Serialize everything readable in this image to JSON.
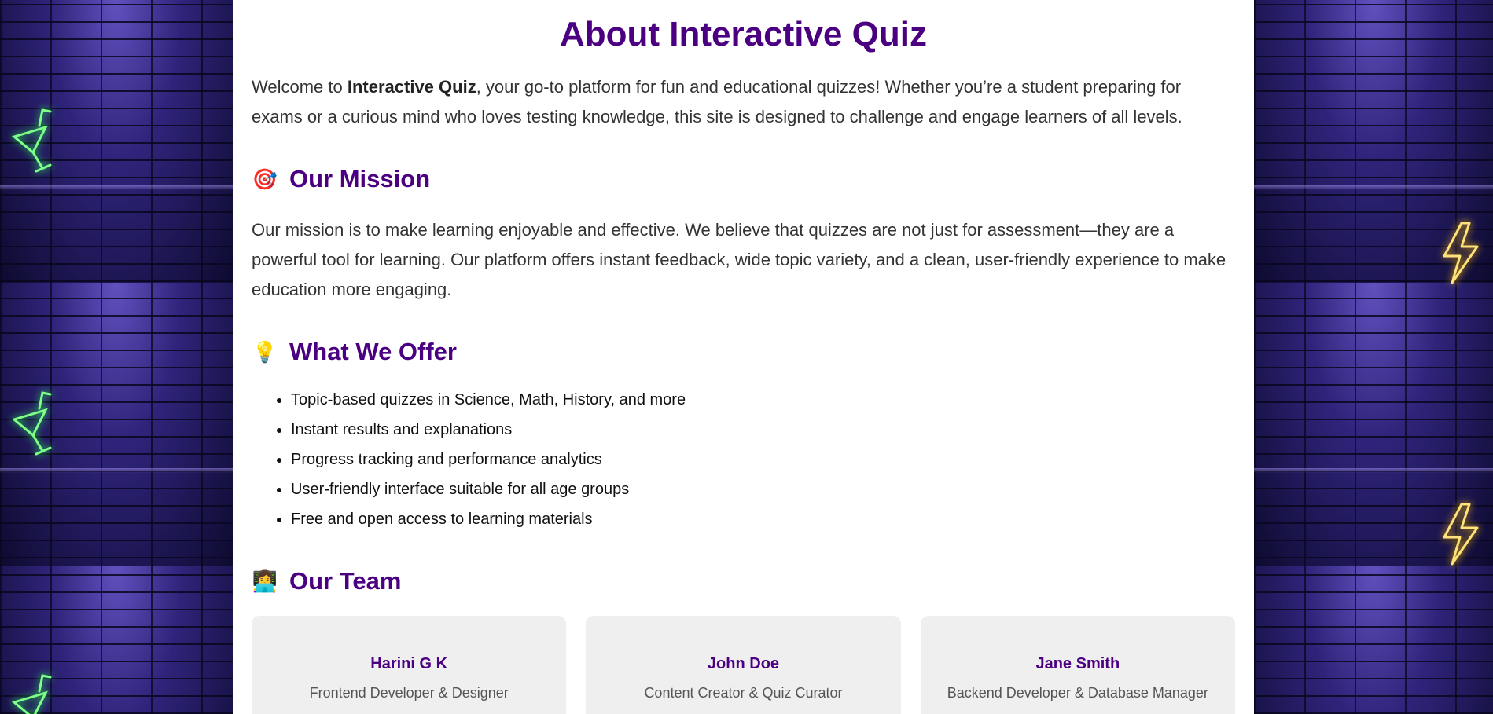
{
  "page": {
    "title": "About Interactive Quiz",
    "intro": {
      "prefix": "Welcome to ",
      "brand": "Interactive Quiz",
      "suffix": ", your go-to platform for fun and educational quizzes! Whether you’re a student preparing for exams or a curious mind who loves testing knowledge, this site is designed to challenge and engage learners of all levels."
    }
  },
  "mission": {
    "icon": "🎯",
    "heading": "Our Mission",
    "text": "Our mission is to make learning enjoyable and effective. We believe that quizzes are not just for assessment—they are a powerful tool for learning. Our platform offers instant feedback, wide topic variety, and a clean, user-friendly experience to make education more engaging."
  },
  "offer": {
    "icon": "💡",
    "heading": "What We Offer",
    "items": [
      "Topic-based quizzes in Science, Math, History, and more",
      "Instant results and explanations",
      "Progress tracking and performance analytics",
      "User-friendly interface suitable for all age groups",
      "Free and open access to learning materials"
    ]
  },
  "team": {
    "icon": "👩‍💻",
    "heading": "Our Team",
    "members": [
      {
        "name": "Harini G K",
        "role": "Frontend Developer & Designer"
      },
      {
        "name": "John Doe",
        "role": "Content Creator & Quiz Curator"
      },
      {
        "name": "Jane Smith",
        "role": "Backend Developer & Database Manager"
      }
    ]
  },
  "decor": {
    "left_icon": "neon-cocktail-icon",
    "right_icon": "neon-lightning-icon",
    "colors": {
      "accent": "#4b0082",
      "neon_green": "#7dff8a",
      "neon_yellow": "#ffe27a",
      "card_bg": "#efefef"
    }
  }
}
